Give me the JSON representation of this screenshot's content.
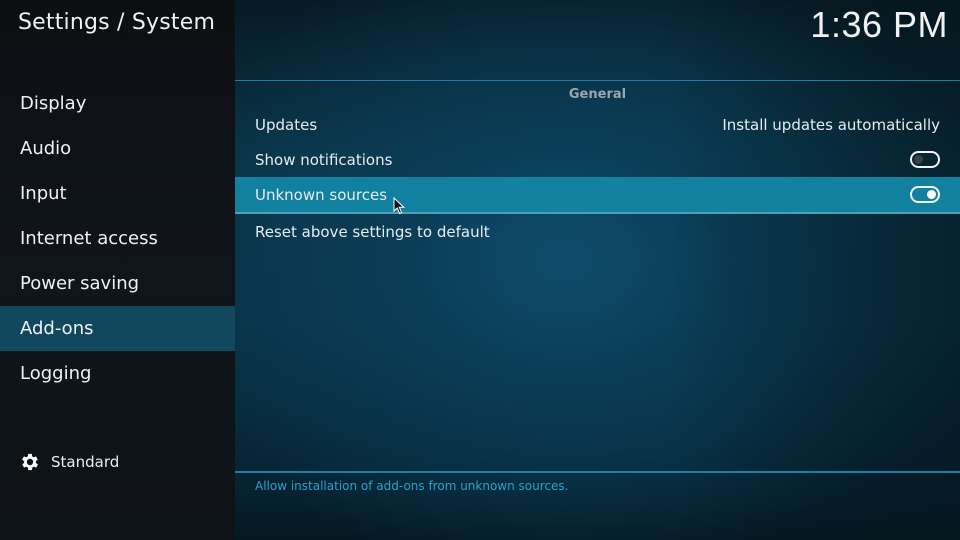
{
  "header": {
    "title": "Settings / System",
    "clock": "1:36 PM"
  },
  "sidebar": {
    "items": [
      {
        "label": "Display",
        "active": false
      },
      {
        "label": "Audio",
        "active": false
      },
      {
        "label": "Input",
        "active": false
      },
      {
        "label": "Internet access",
        "active": false
      },
      {
        "label": "Power saving",
        "active": false
      },
      {
        "label": "Add-ons",
        "active": true
      },
      {
        "label": "Logging",
        "active": false
      }
    ],
    "settings_level": {
      "icon": "gear-icon",
      "label": "Standard"
    }
  },
  "main": {
    "group_label": "General",
    "settings": [
      {
        "label": "Updates",
        "value": "Install updates automatically"
      },
      {
        "label": "Show notifications",
        "toggle": "off"
      },
      {
        "label": "Unknown sources",
        "toggle": "on",
        "focused": true
      },
      {
        "label": "Reset above settings to default"
      }
    ],
    "help_text": "Allow installation of add-ons from unknown sources."
  },
  "colors": {
    "accent": "#12819f",
    "sidebar_active": "#12485e",
    "help_text": "#2c9fcc",
    "divider": "#1c7fa3"
  }
}
